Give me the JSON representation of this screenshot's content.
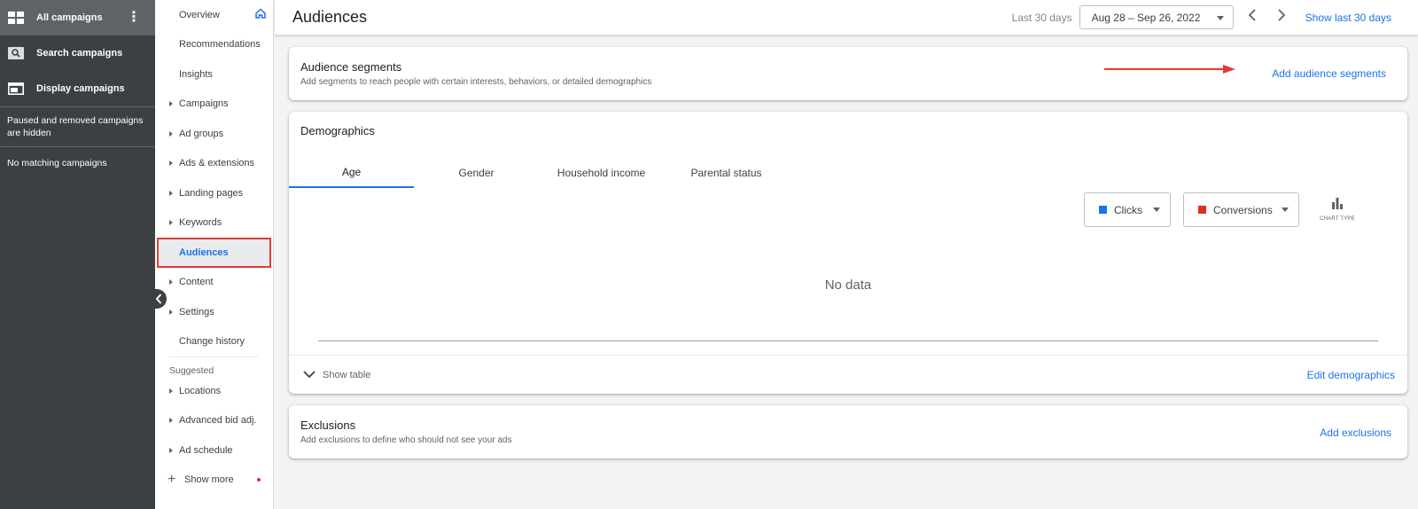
{
  "campaign_panel": {
    "all_campaigns": "All campaigns",
    "search_campaigns": "Search campaigns",
    "display_campaigns": "Display campaigns",
    "note": "Paused and removed campaigns are hidden",
    "no_match": "No matching campaigns"
  },
  "nav": {
    "items": [
      {
        "label": "Overview"
      },
      {
        "label": "Recommendations"
      },
      {
        "label": "Insights"
      },
      {
        "label": "Campaigns"
      },
      {
        "label": "Ad groups"
      },
      {
        "label": "Ads & extensions"
      },
      {
        "label": "Landing pages"
      },
      {
        "label": "Keywords"
      },
      {
        "label": "Audiences"
      },
      {
        "label": "Content"
      },
      {
        "label": "Settings"
      },
      {
        "label": "Change history"
      }
    ],
    "suggested_label": "Suggested",
    "suggested": [
      {
        "label": "Locations"
      },
      {
        "label": "Advanced bid adj."
      },
      {
        "label": "Ad schedule"
      }
    ],
    "show_more": "Show more"
  },
  "header": {
    "title": "Audiences",
    "range_label": "Last 30 days",
    "date_range": "Aug 28 – Sep 26, 2022",
    "show_last": "Show last 30 days"
  },
  "segments": {
    "title": "Audience segments",
    "subtitle": "Add segments to reach people with certain interests, behaviors, or detailed demographics",
    "action": "Add audience segments"
  },
  "demographics": {
    "title": "Demographics",
    "tabs": [
      "Age",
      "Gender",
      "Household income",
      "Parental status"
    ],
    "metric1": "Clicks",
    "metric1_color": "#1a73e8",
    "metric2": "Conversions",
    "metric2_color": "#d93025",
    "chart_type_label": "CHART TYPE",
    "empty": "No data",
    "show_table": "Show table",
    "edit": "Edit demographics"
  },
  "exclusions": {
    "title": "Exclusions",
    "subtitle": "Add exclusions to define who should not see your ads",
    "action": "Add exclusions"
  }
}
